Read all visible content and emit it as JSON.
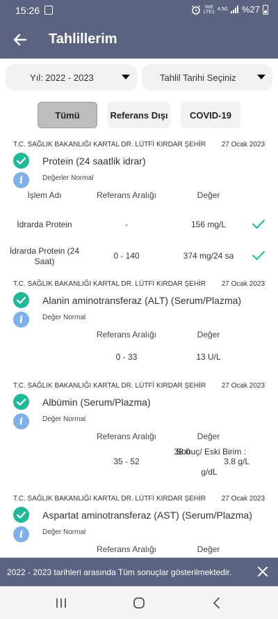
{
  "status_bar": {
    "time": "15:26",
    "net_top": "Vo0",
    "net_bottom": "LTE1",
    "net_gen": "4.5G",
    "battery": "%27"
  },
  "app_bar": {
    "title": "Tahlillerim"
  },
  "filters": {
    "year": {
      "label": "Yıl: 2022 - 2023"
    },
    "date": {
      "label": "Tahlil Tarihi Seçiniz"
    }
  },
  "tabs": [
    {
      "label": "Tümü",
      "active": true
    },
    {
      "label": "Referans Dışı",
      "active": false
    },
    {
      "label": "COVID-19",
      "active": false
    }
  ],
  "results": [
    {
      "hospital": "T.C. SAĞLIK BAKANLIĞI KARTAL DR. LÜTFİ KIRDAR ŞEHİR",
      "date": "27 Ocak 2023",
      "test": "Protein (24 saatlik idrar)",
      "status": "Değerler Normal",
      "headers": {
        "name": "İşlem Adı",
        "range": "Referans Aralığı",
        "value": "Değer"
      },
      "rows": [
        {
          "name": "İdrarda Protein",
          "range": "-",
          "value": "156 mg/L"
        },
        {
          "name": "İdrarda Protein (24 Saat)",
          "range": "0 - 140",
          "value": "374 mg/24 sa"
        }
      ]
    },
    {
      "hospital": "T.C. SAĞLIK BAKANLIĞI KARTAL DR. LÜTFİ KIRDAR ŞEHİR",
      "date": "27 Ocak 2023",
      "test": "Alanin aminotransferaz (ALT) (Serum/Plazma)",
      "status": "Değer Normal",
      "headers": {
        "range": "Referans Aralığı",
        "value": "Değer"
      },
      "rows": [
        {
          "range": "0 - 33",
          "value": "13 U/L"
        }
      ]
    },
    {
      "hospital": "T.C. SAĞLIK BAKANLIĞI KARTAL DR. LÜTFİ KIRDAR ŞEHİR",
      "date": "27 Ocak 2023",
      "test": "Albümin (Serum/Plazma)",
      "status": "Değer Normal",
      "headers": {
        "range": "Referans Aralığı",
        "value": "Değer"
      },
      "rows": [
        {
          "range": "35 - 52",
          "value_line1": "38.0",
          "value_line2": "g/dL",
          "old_label": "Sonuç/ Eski Birim :",
          "old_value": "3.8 g/L"
        }
      ]
    },
    {
      "hospital": "T.C. SAĞLIK BAKANLIĞI KARTAL DR. LÜTFİ KIRDAR ŞEHİR",
      "date": "27 Ocak 2023",
      "test": "Aspartat aminotransferaz (AST) (Serum/Plazma)",
      "status": "Değer Normal",
      "headers": {
        "range": "Referans Aralığı",
        "value": "Değer"
      }
    }
  ],
  "snackbar": {
    "message": "2022 - 2023 tarihleri arasında Tüm sonuçlar gösterilmektedir."
  },
  "colors": {
    "primary": "#5a6480",
    "success": "#22b89a",
    "info": "#7fb0e8",
    "chip_bg": "#f2f2f4",
    "chip_active": "#bdbdbd"
  }
}
